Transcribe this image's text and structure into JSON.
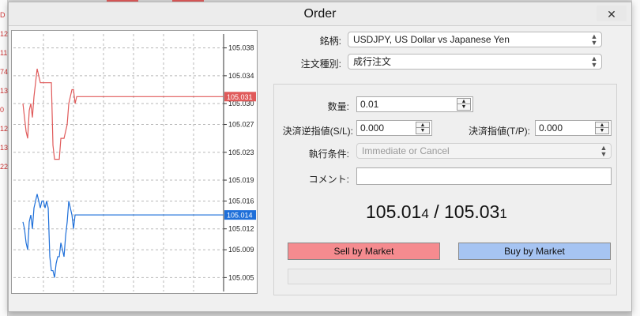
{
  "window": {
    "title": "Order",
    "close_glyph": "✕"
  },
  "chart": {
    "y_ticks": [
      "105.038",
      "105.034",
      "105.030",
      "105.027",
      "105.023",
      "105.019",
      "105.016",
      "105.012",
      "105.009",
      "105.005"
    ],
    "ask_label": "105.031",
    "bid_label": "105.014",
    "ask_color": "#e05a5a",
    "bid_color": "#1e6fd9"
  },
  "chart_data": {
    "type": "line",
    "ylim": [
      105.003,
      105.04
    ],
    "grid": true,
    "series": [
      {
        "values": [
          105.03,
          105.028,
          105.026,
          105.025,
          105.029,
          105.03,
          105.028,
          105.031,
          105.033,
          105.035,
          105.034,
          105.033,
          105.033,
          105.033,
          105.033,
          105.033,
          105.033,
          105.033,
          105.033,
          105.024,
          105.022,
          105.022,
          105.022,
          105.022,
          105.025,
          105.025,
          105.025,
          105.026,
          105.027,
          105.03,
          105.031,
          105.032,
          105.032,
          105.03,
          105.031,
          105.031,
          105.031,
          105.031,
          105.031,
          105.031,
          105.031,
          105.031,
          105.031,
          105.031,
          105.031,
          105.031,
          105.031,
          105.031,
          105.031,
          105.031,
          105.031,
          105.031,
          105.031,
          105.031,
          105.031,
          105.031,
          105.031,
          105.031,
          105.031,
          105.031
        ]
      },
      {
        "values": [
          105.013,
          105.012,
          105.01,
          105.009,
          105.013,
          105.014,
          105.012,
          105.015,
          105.016,
          105.017,
          105.016,
          105.015,
          105.016,
          105.016,
          105.015,
          105.016,
          105.015,
          105.008,
          105.006,
          105.006,
          105.005,
          105.007,
          105.008,
          105.008,
          105.01,
          105.009,
          105.008,
          105.011,
          105.013,
          105.016,
          105.015,
          105.014,
          105.012,
          105.014,
          105.014,
          105.014,
          105.014,
          105.014,
          105.014,
          105.014,
          105.014,
          105.014,
          105.014,
          105.014,
          105.014,
          105.014,
          105.014,
          105.014,
          105.014,
          105.014,
          105.014,
          105.014,
          105.014,
          105.014,
          105.014,
          105.014,
          105.014,
          105.014,
          105.014,
          105.014
        ]
      }
    ]
  },
  "form": {
    "symbol_label": "銘柄:",
    "symbol_value": "USDJPY, US Dollar vs Japanese Yen",
    "order_type_label": "注文種別:",
    "order_type_value": "成行注文",
    "volume_label": "数量:",
    "volume_value": "0.01",
    "sl_label": "決済逆指値(S/L):",
    "sl_value": "0.000",
    "tp_label": "決済指値(T/P):",
    "tp_value": "0.000",
    "fill_label": "執行条件:",
    "fill_value": "Immediate or Cancel",
    "comment_label": "コメント:",
    "comment_value": ""
  },
  "quote": {
    "bid_main": "105.01",
    "bid_small": "4",
    "separator": " / ",
    "ask_main": "105.03",
    "ask_small": "1"
  },
  "buttons": {
    "sell": "Sell by Market",
    "buy": "Buy by Market"
  },
  "background": {
    "left_marks": [
      "D",
      "12",
      "11",
      "74",
      "13",
      "0",
      "12",
      "13",
      "22"
    ]
  }
}
